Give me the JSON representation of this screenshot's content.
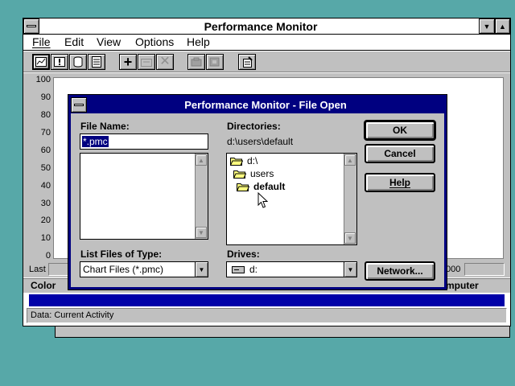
{
  "main_window": {
    "title": "Performance Monitor",
    "menu": [
      "File",
      "Edit",
      "View",
      "Options",
      "Help"
    ],
    "y_axis": [
      "100",
      "90",
      "80",
      "70",
      "60",
      "50",
      "40",
      "30",
      "20",
      "10",
      "0"
    ],
    "last_label": "Last",
    "value_fragment": "000",
    "legend_color_label": "Color",
    "legend_computer_fragment": "mputer",
    "status_text": "Data: Current Activity",
    "toolbar_icons": [
      "chart-view-icon",
      "alert-view-icon",
      "log-view-icon",
      "report-view-icon",
      "add-counter-icon",
      "edit-counter-icon",
      "delete-counter-icon",
      "update-now-icon",
      "bookmark-icon",
      "options-icon"
    ]
  },
  "dialog": {
    "title": "Performance Monitor - File Open",
    "file_name_label": "File Name:",
    "file_name_value": "*.pmc",
    "directories_label": "Directories:",
    "current_dir": "d:\\users\\default",
    "dir_tree": [
      "d:\\",
      "users",
      "default"
    ],
    "list_type_label": "List Files of Type:",
    "list_type_value": "Chart Files (*.pmc)",
    "drives_label": "Drives:",
    "drive_value": "d:",
    "buttons": {
      "ok": "OK",
      "cancel": "Cancel",
      "help": "Help",
      "network": "Network..."
    }
  },
  "colors": {
    "desktop": "#57a8a8",
    "titlebar": "#000080",
    "face": "#c0c0c0",
    "selection": "#000080"
  }
}
